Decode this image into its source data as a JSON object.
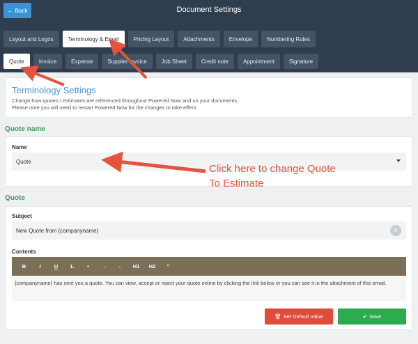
{
  "header": {
    "back_label": "Back",
    "back_icon": "arrow-left-icon",
    "title": "Document Settings"
  },
  "main_tabs": [
    {
      "label": "Layout and Logos",
      "active": false
    },
    {
      "label": "Terminology & Email",
      "active": true
    },
    {
      "label": "Pricing Layout",
      "active": false
    },
    {
      "label": "Attachments",
      "active": false
    },
    {
      "label": "Envelope",
      "active": false
    },
    {
      "label": "Numbering Rules",
      "active": false
    }
  ],
  "sub_tabs": [
    {
      "label": "Quote",
      "active": true
    },
    {
      "label": "Invoice",
      "active": false
    },
    {
      "label": "Expense",
      "active": false
    },
    {
      "label": "Supplier invoice",
      "active": false
    },
    {
      "label": "Job Sheet",
      "active": false
    },
    {
      "label": "Credit note",
      "active": false
    },
    {
      "label": "Appointment",
      "active": false
    },
    {
      "label": "Signature",
      "active": false
    }
  ],
  "terminology": {
    "title": "Terminology Settings",
    "line1": "Change how quotes / estimates are referenced throughout Powered Now and on your documents.",
    "line2": "Please note you will need to restart Powered Now for the changes to take effect."
  },
  "quote_name": {
    "section_title": "Quote name",
    "field_label": "Name",
    "selected_value": "Quote"
  },
  "quote": {
    "section_title": "Quote",
    "subject_label": "Subject",
    "subject_value": "New Quote from {companyname}",
    "contents_label": "Contents",
    "toolbar": [
      "B",
      "I",
      "U",
      "1.",
      "•",
      "→",
      "←",
      "H1",
      "H2",
      "\""
    ],
    "contents_text": "{companyname} has sent you a quote. You can view, accept or reject your quote online by clicking the link below or you can see it in the attachment of this email.",
    "default_button": "Set Default value",
    "default_icon": "trash-icon",
    "save_button": "Save",
    "save_icon": "checkmark-icon"
  },
  "annotation": {
    "line1": "Click here to change Quote",
    "line2": "To Estimate"
  },
  "colors": {
    "header_bg": "#2f3e4e",
    "accent_blue": "#3a93d6",
    "section_green": "#3f9d57",
    "toolbar_brown": "#7b6f57",
    "danger": "#e04b3b",
    "success": "#2eaa4f",
    "annotation_red": "#e3543c"
  }
}
